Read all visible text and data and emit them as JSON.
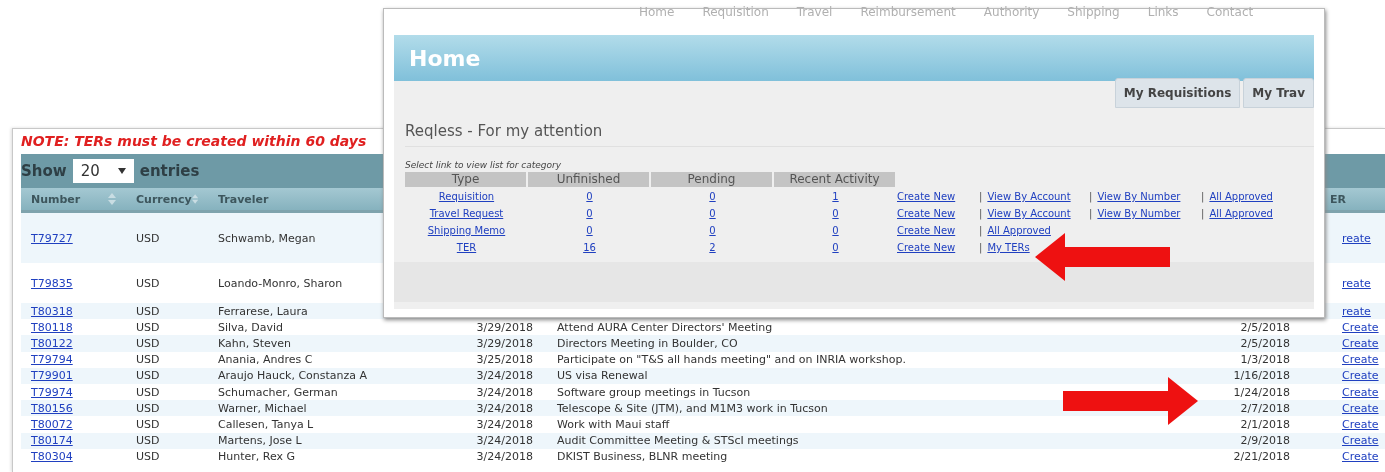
{
  "background_page": {
    "note": "NOTE: TERs must be created within 60 days",
    "length_control": {
      "label_before": "Show",
      "value": "20",
      "label_after": "entries"
    },
    "table": {
      "columns": [
        {
          "label": "Number",
          "sortable": true
        },
        {
          "label": "Currency",
          "sortable": true
        },
        {
          "label": "Traveler"
        },
        {
          "label": "ER"
        }
      ],
      "rows": [
        {
          "number": "T79727",
          "currency": "USD",
          "traveler": "Schwamb, Megan",
          "action": "reate"
        },
        {
          "number": "T79835",
          "currency": "USD",
          "traveler": "Loando-Monro, Sharon",
          "action": "reate"
        },
        {
          "number": "T80318",
          "currency": "USD",
          "traveler": "Ferrarese, Laura",
          "action": "reate"
        },
        {
          "number": "T80118",
          "currency": "USD",
          "traveler": "Silva, David",
          "submitted": "3/29/2018",
          "purpose": "Attend AURA Center Directors' Meeting",
          "trip_date": "2/5/2018",
          "action": "Create"
        },
        {
          "number": "T80122",
          "currency": "USD",
          "traveler": "Kahn, Steven",
          "submitted": "3/29/2018",
          "purpose": "Directors Meeting in Boulder, CO",
          "trip_date": "2/5/2018",
          "action": "Create"
        },
        {
          "number": "T79794",
          "currency": "USD",
          "traveler": "Anania, Andres C",
          "submitted": "3/25/2018",
          "purpose": "Participate on \"T&S all hands meeting\" and on INRIA workshop.",
          "trip_date": "1/3/2018",
          "action": "Create"
        },
        {
          "number": "T79901",
          "currency": "USD",
          "traveler": "Araujo Hauck, Constanza A",
          "submitted": "3/24/2018",
          "purpose": "US visa Renewal",
          "trip_date": "1/16/2018",
          "action": "Create"
        },
        {
          "number": "T79974",
          "currency": "USD",
          "traveler": "Schumacher, German",
          "submitted": "3/24/2018",
          "purpose": "Software group meetings in Tucson",
          "trip_date": "1/24/2018",
          "action": "Create"
        },
        {
          "number": "T80156",
          "currency": "USD",
          "traveler": "Warner, Michael",
          "submitted": "3/24/2018",
          "purpose": "Telescope & Site (JTM), and M1M3 work in Tucson",
          "trip_date": "2/7/2018",
          "action": "Create"
        },
        {
          "number": "T80072",
          "currency": "USD",
          "traveler": "Callesen, Tanya L",
          "submitted": "3/24/2018",
          "purpose": "Work with Maui staff",
          "trip_date": "2/1/2018",
          "action": "Create"
        },
        {
          "number": "T80174",
          "currency": "USD",
          "traveler": "Martens, Jose L",
          "submitted": "3/24/2018",
          "purpose": "Audit Committee Meeting & STScI meetings",
          "trip_date": "2/9/2018",
          "action": "Create"
        },
        {
          "number": "T80304",
          "currency": "USD",
          "traveler": "Hunter, Rex G",
          "submitted": "3/24/2018",
          "purpose": "DKIST Business, BLNR meeting",
          "trip_date": "2/21/2018",
          "action": "Create"
        }
      ]
    }
  },
  "overlay_window": {
    "nav": [
      "Home",
      "Requisition",
      "Travel",
      "Reimbursement",
      "Authority",
      "Shipping",
      "Links",
      "Contact"
    ],
    "title": "Home",
    "tabs": [
      "My Requisitions",
      "My Trav"
    ],
    "section_title": "Reqless - For my attention",
    "hint": "Select link to view list for category",
    "table": {
      "columns": [
        "Type",
        "Unfinished",
        "Pending",
        "Recent Activity"
      ],
      "rows": [
        {
          "type": "Requisition",
          "unfinished": "0",
          "pending": "0",
          "recent": "1",
          "links": [
            {
              "text": "Create New"
            },
            {
              "separator": "|",
              "text": "View By Account"
            },
            {
              "separator": "|",
              "text": "View By Number"
            },
            {
              "separator": "|",
              "text": "All Approved"
            }
          ]
        },
        {
          "type": "Travel Request",
          "unfinished": "0",
          "pending": "0",
          "recent": "0",
          "links": [
            {
              "text": "Create New"
            },
            {
              "separator": "|",
              "text": "View By Account"
            },
            {
              "separator": "|",
              "text": "View By Number"
            },
            {
              "separator": "|",
              "text": "All Approved"
            }
          ]
        },
        {
          "type": "Shipping Memo",
          "unfinished": "0",
          "pending": "0",
          "recent": "0",
          "links": [
            {
              "text": "Create New"
            },
            {
              "separator": "|",
              "text": "All Approved"
            }
          ]
        },
        {
          "type": "TER",
          "unfinished": "16",
          "pending": "2",
          "recent": "0",
          "links": [
            {
              "text": "Create New"
            },
            {
              "separator": "|",
              "text": "My TERs"
            }
          ]
        }
      ]
    }
  },
  "annotations": [
    {
      "kind": "arrow_left"
    },
    {
      "kind": "arrow_right"
    }
  ]
}
